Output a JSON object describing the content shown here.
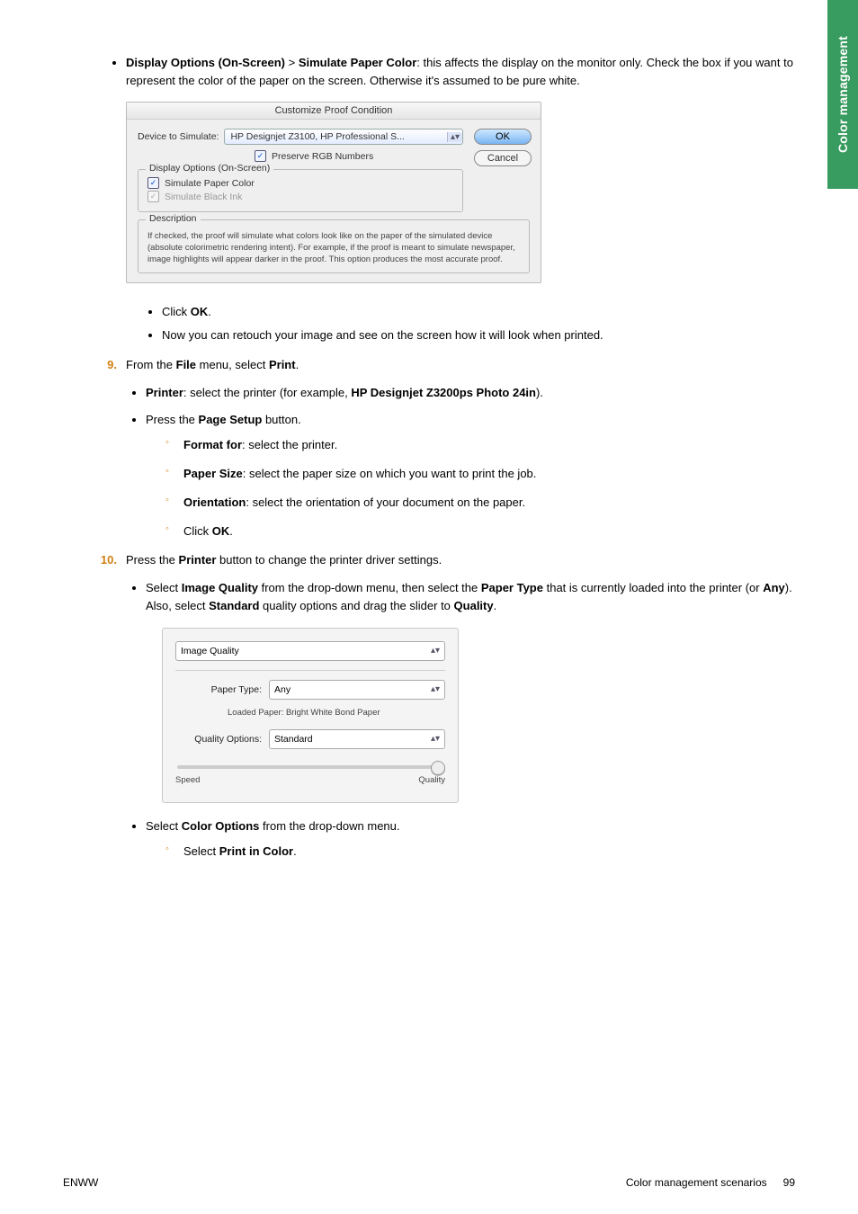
{
  "side_tab": "Color management",
  "top_bullet": {
    "prefix_bold": "Display Options (On-Screen)",
    "gt": " > ",
    "suffix_bold": "Simulate Paper Color",
    "rest": ": this affects the display on the monitor only. Check the box if you want to represent the color of the paper on the screen. Otherwise it's assumed to be pure white."
  },
  "dialog1": {
    "title": "Customize Proof Condition",
    "device_label": "Device to Simulate:",
    "device_value": "HP Designjet Z3100, HP Professional S...",
    "preserve": "Preserve RGB Numbers",
    "group1_legend": "Display Options (On-Screen)",
    "chk_sim_paper": "Simulate Paper Color",
    "chk_sim_black": "Simulate Black Ink",
    "group2_legend": "Description",
    "desc": "If checked, the proof will simulate what colors look like on the paper of the simulated device (absolute colorimetric rendering intent). For example, if the proof is meant to simulate newspaper, image highlights will appear darker in the proof. This option produces the most accurate proof.",
    "ok": "OK",
    "cancel": "Cancel"
  },
  "sub_bullets": {
    "click_ok_pre": "Click ",
    "click_ok_bold": "OK",
    "click_ok_post": ".",
    "retouch": "Now you can retouch your image and see on the screen how it will look when printed."
  },
  "step9": {
    "pre": "From the ",
    "menu_bold": "File",
    "mid": " menu, select ",
    "print_bold": "Print",
    "post": "."
  },
  "step9_bullets": {
    "printer_pre": "Printer",
    "printer_rest": ": select the printer (for example, ",
    "printer_example": "HP Designjet Z3200ps Photo 24in",
    "printer_close": ").",
    "page_setup_pre": "Press the ",
    "page_setup_bold": "Page Setup",
    "page_setup_post": " button."
  },
  "step9_circ": {
    "format_pre": "Format for",
    "format_rest": ": select the printer.",
    "paper_pre": "Paper Size",
    "paper_rest": ": select the paper size on which you want to print the job.",
    "orient_pre": "Orientation",
    "orient_rest": ": select the orientation of your document on the paper.",
    "click_ok_pre": "Click ",
    "click_ok_bold": "OK",
    "click_ok_post": "."
  },
  "step10": {
    "pre": "Press the ",
    "printer_bold": "Printer",
    "post": " button to change the printer driver settings."
  },
  "step10_bullet": {
    "pre": "Select ",
    "iq": "Image Quality",
    "mid1": " from the drop-down menu, then select the ",
    "ptype": "Paper Type",
    "mid2": " that is currently loaded into the printer (or ",
    "any": "Any",
    "mid3": "). Also, select ",
    "std": "Standard",
    "mid4": " quality options and drag the slider to ",
    "quality": "Quality",
    "post": "."
  },
  "panel2": {
    "top_sel": "Image Quality",
    "paper_type_label": "Paper Type:",
    "paper_type_value": "Any",
    "loaded_label": "Loaded Paper: Bright White Bond Paper",
    "quality_opt_label": "Quality Options:",
    "quality_opt_value": "Standard",
    "slider_left": "Speed",
    "slider_right": "Quality"
  },
  "after_panel2": {
    "pre": "Select ",
    "co": "Color Options",
    "post": " from the drop-down menu.",
    "sub_pre": "Select ",
    "sub_bold": "Print in Color",
    "sub_post": "."
  },
  "footer": {
    "left": "ENWW",
    "right_text": "Color management scenarios",
    "page_num": "99"
  }
}
